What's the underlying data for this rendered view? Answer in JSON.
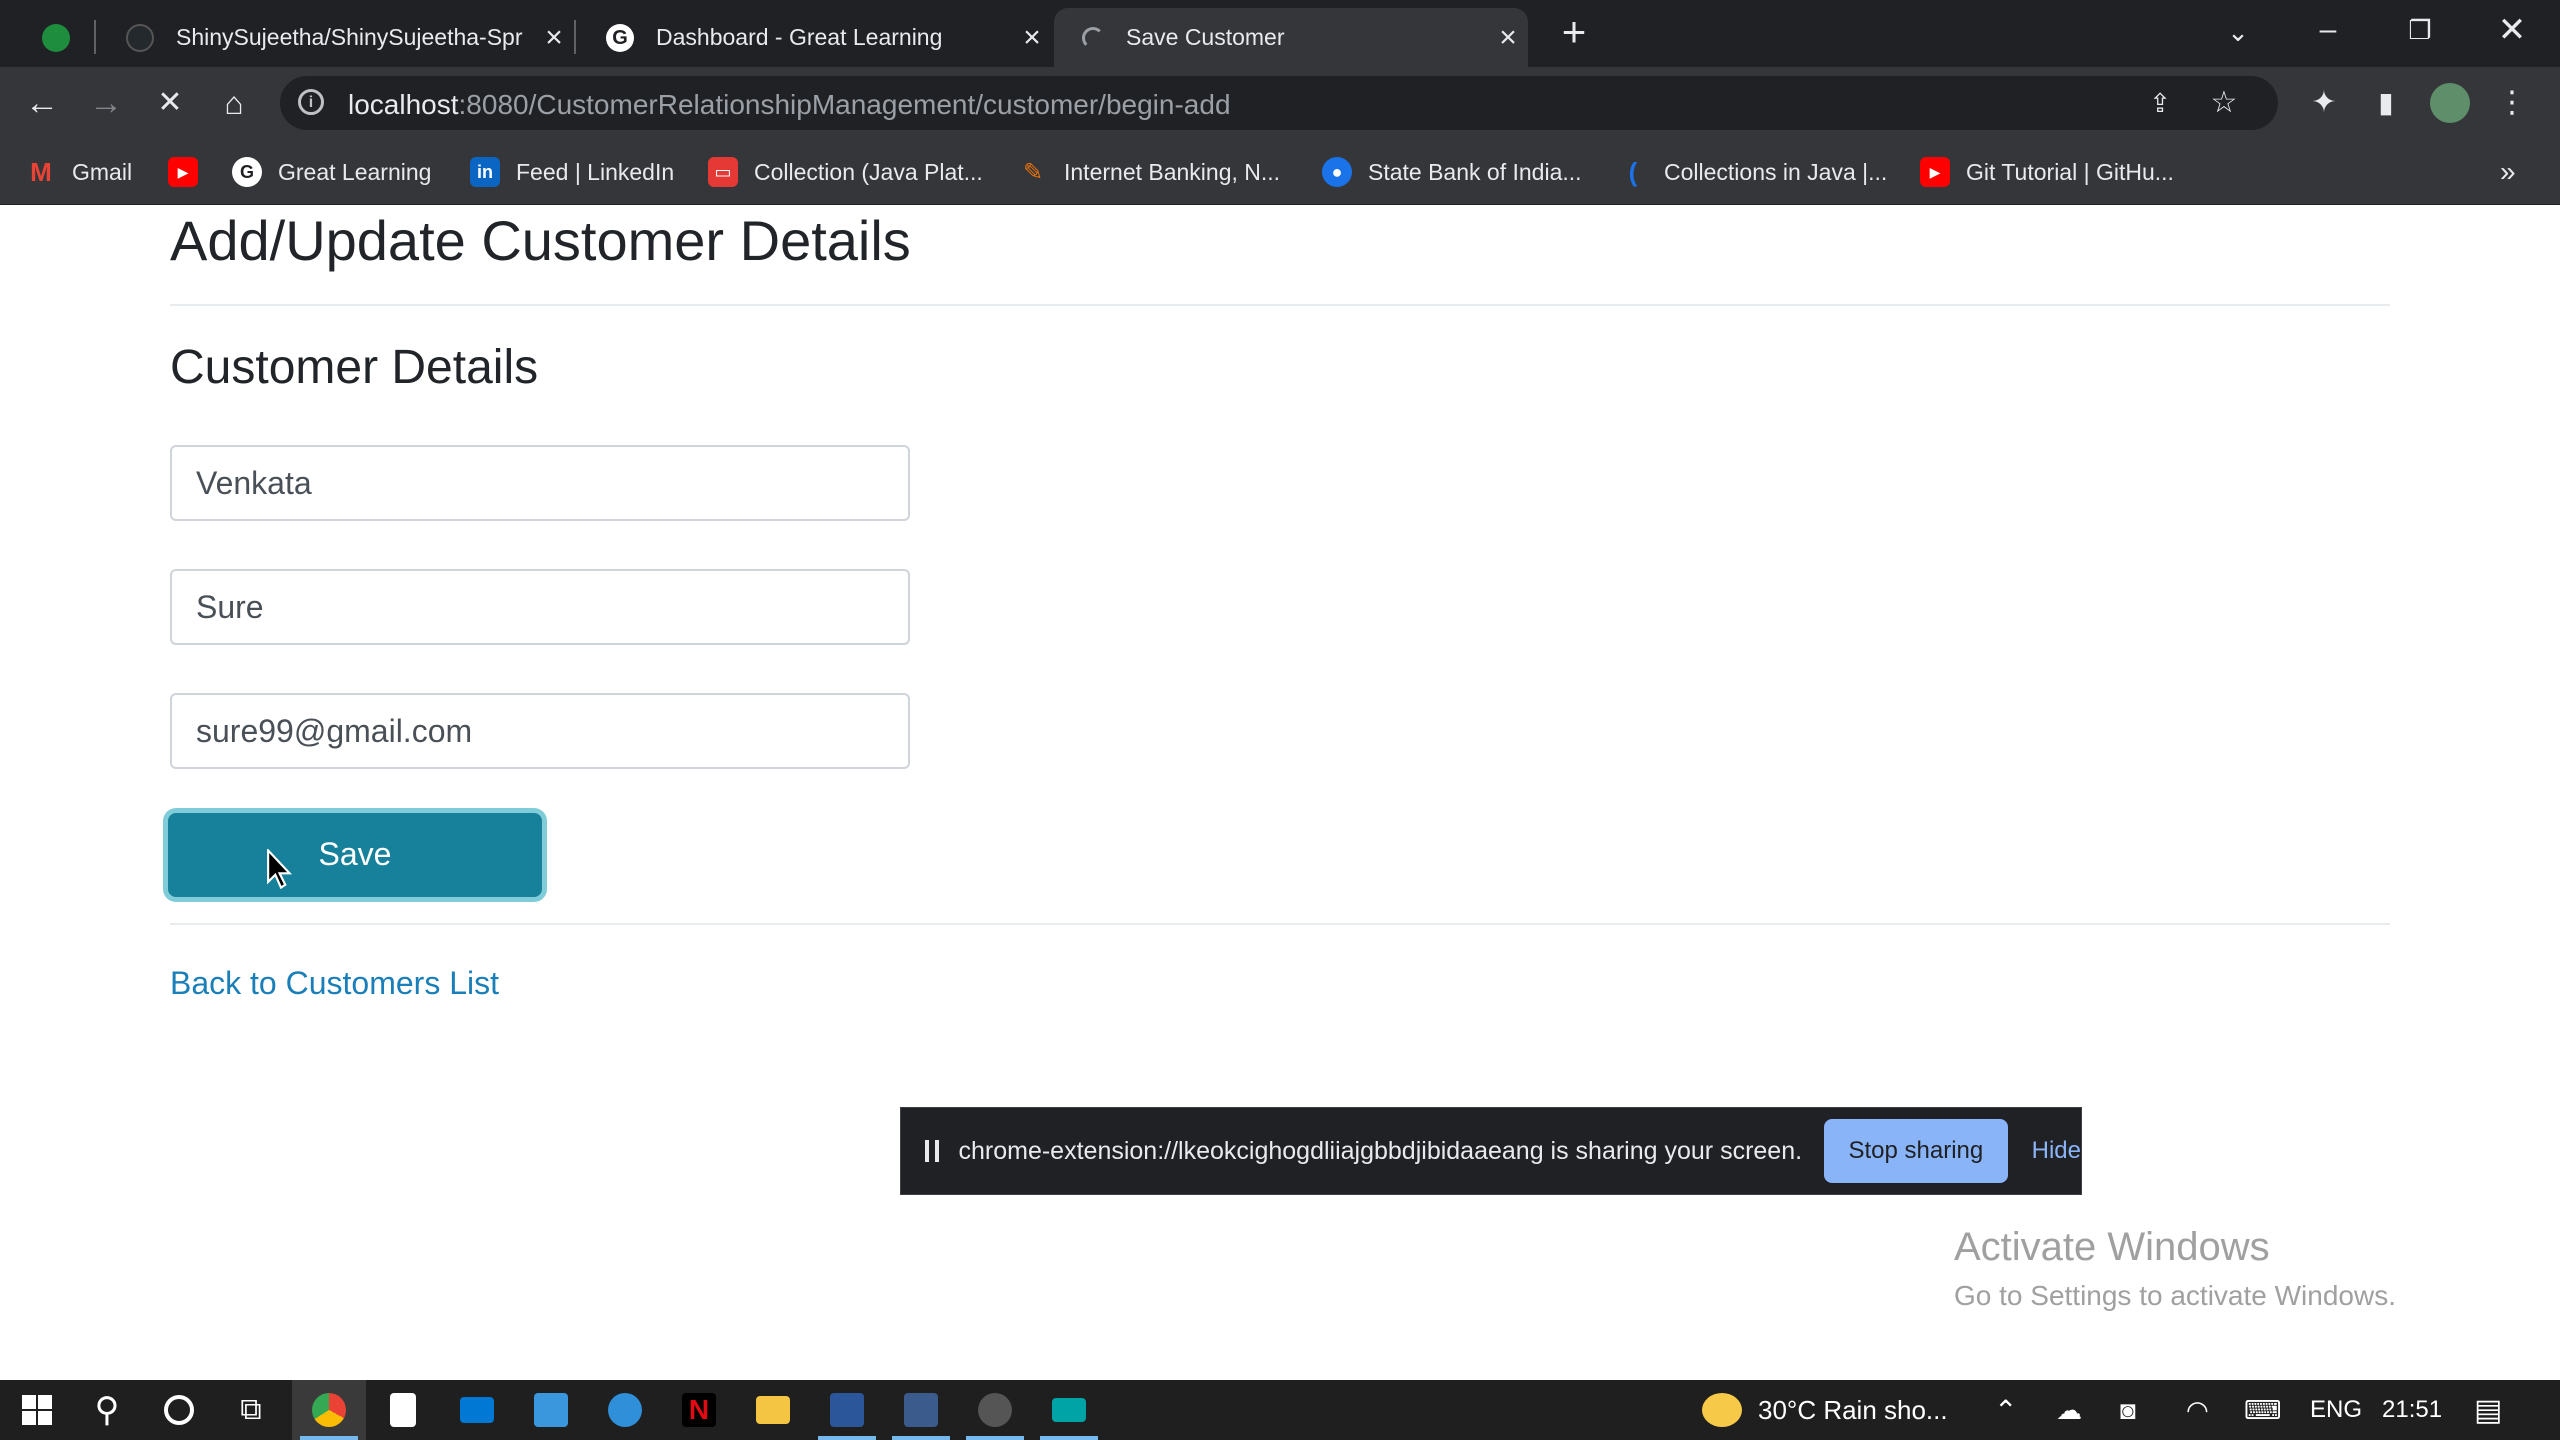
{
  "browser": {
    "tabs": [
      {
        "title": "ShinySujeetha/ShinySujeetha-Spr",
        "active": false
      },
      {
        "title": "Dashboard - Great Learning",
        "active": false
      },
      {
        "title": "Save Customer",
        "active": true
      }
    ],
    "new_tab_icon": "plus-icon",
    "url_host": "localhost",
    "url_rest": ":8080/CustomerRelationshipManagement/customer/begin-add",
    "bookmarks": [
      "Gmail",
      "",
      "Great Learning",
      "Feed | LinkedIn",
      "Collection (Java Plat...",
      "Internet Banking, N...",
      "State Bank of India...",
      "Collections in Java |...",
      "Git Tutorial | GitHu..."
    ]
  },
  "page": {
    "title": "Add/Update Customer Details",
    "section_title": "Customer Details",
    "fields": {
      "first_name": "Venkata",
      "last_name": "Sure",
      "email": "sure99@gmail.com"
    },
    "save_label": "Save",
    "back_link": "Back to Customers List"
  },
  "screen_share": {
    "message": "chrome-extension://lkeokcighogdliiajgbbdjibidaaeang is sharing your screen.",
    "stop_label": "Stop sharing",
    "hide_label": "Hide"
  },
  "watermark": {
    "line1": "Activate Windows",
    "line2": "Go to Settings to activate Windows."
  },
  "taskbar": {
    "weather": "30°C  Rain sho...",
    "lang": "ENG",
    "time": "21:51"
  },
  "colors": {
    "accent": "#17809a",
    "link": "#1a7fb8",
    "share_button": "#8ab4f8"
  }
}
